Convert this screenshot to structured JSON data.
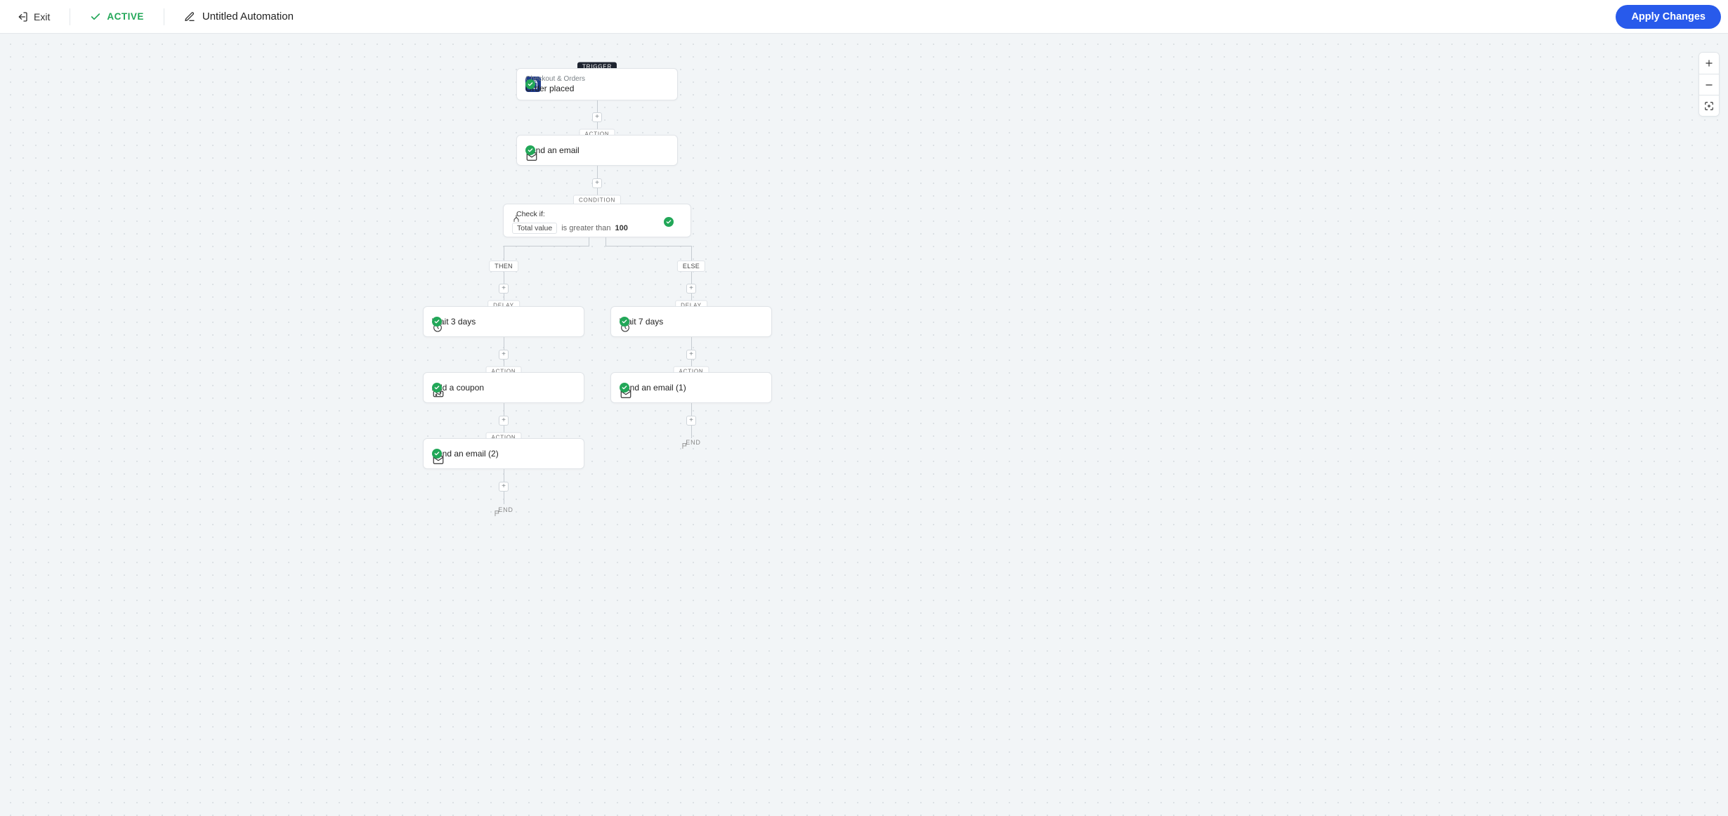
{
  "topbar": {
    "exit": "Exit",
    "status": "ACTIVE",
    "title": "Untitled Automation",
    "apply": "Apply Changes"
  },
  "labels": {
    "trigger": "TRIGGER",
    "action": "ACTION",
    "condition": "CONDITION",
    "delay": "DELAY",
    "then": "THEN",
    "else": "ELSE",
    "end": "END"
  },
  "nodes": {
    "trigger": {
      "category": "Checkout & Orders",
      "title": "Order placed"
    },
    "action_email_1": "Send an email",
    "condition": {
      "check": "Check if:",
      "field": "Total value",
      "operator": "is greater than",
      "value": "100"
    },
    "then": {
      "delay": "Wait 3 days",
      "coupon": "Add a coupon",
      "email": "Send an email (2)"
    },
    "else": {
      "delay": "Wait 7 days",
      "email": "Send an email (1)"
    }
  }
}
